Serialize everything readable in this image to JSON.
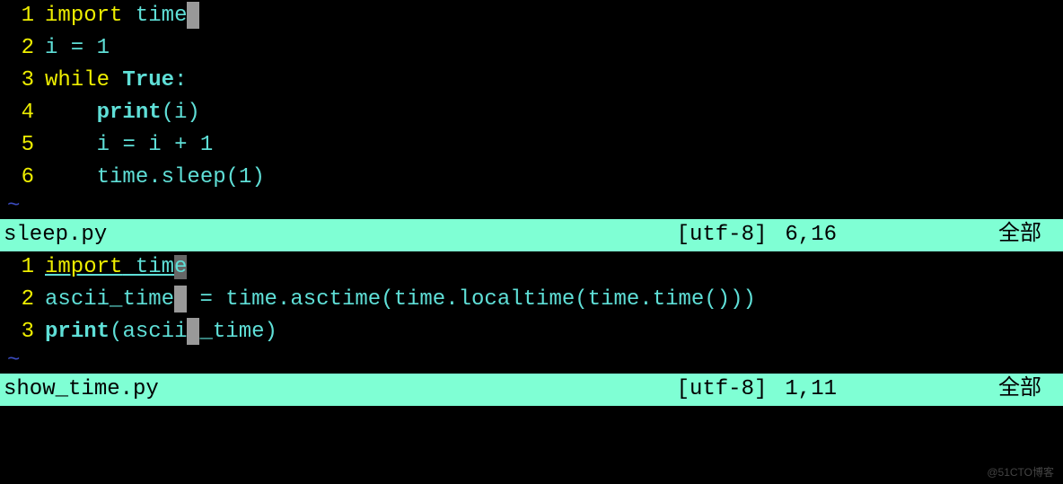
{
  "pane1": {
    "lines": [
      {
        "num": "1",
        "tokens": [
          {
            "t": "import",
            "cls": "keyword"
          },
          {
            "t": " time",
            "cls": "teal"
          }
        ]
      },
      {
        "num": "2",
        "tokens": [
          {
            "t": "i = 1",
            "cls": "teal"
          }
        ]
      },
      {
        "num": "3",
        "tokens": [
          {
            "t": "while",
            "cls": "keyword"
          },
          {
            "t": " ",
            "cls": "teal"
          },
          {
            "t": "True",
            "cls": "bold-teal"
          },
          {
            "t": ":",
            "cls": "teal"
          }
        ]
      },
      {
        "num": "4",
        "tokens": [
          {
            "t": "    ",
            "cls": "teal"
          },
          {
            "t": "print",
            "cls": "bold-teal"
          },
          {
            "t": "(i)",
            "cls": "teal"
          }
        ]
      },
      {
        "num": "5",
        "tokens": [
          {
            "t": "    i = i + 1",
            "cls": "teal"
          }
        ]
      },
      {
        "num": "6",
        "tokens": [
          {
            "t": "    time.sleep(1)",
            "cls": "teal"
          }
        ]
      }
    ],
    "cursor_marks": {
      "0": 11,
      "4": 15
    },
    "status": {
      "filename": "sleep.py",
      "encoding": "[utf-8]",
      "position": "6,16",
      "scroll": "全部"
    }
  },
  "pane2": {
    "lines": [
      {
        "num": "1",
        "tokens": [
          {
            "t": "import",
            "cls": "keyword underline"
          },
          {
            "t": " tim",
            "cls": "teal underline"
          },
          {
            "t": "e",
            "cls": "cursor-underline"
          }
        ]
      },
      {
        "num": "2",
        "tokens": [
          {
            "t": "ascii_time",
            "cls": "teal"
          },
          {
            "t": " = time.asctime(time.localtime(time.time()))",
            "cls": "teal"
          }
        ]
      },
      {
        "num": "3",
        "tokens": [
          {
            "t": "print",
            "cls": "bold-teal"
          },
          {
            "t": "(asci",
            "cls": "teal"
          },
          {
            "t": "i_time)",
            "cls": "teal"
          }
        ]
      }
    ],
    "cursor_marks": {
      "1": 10,
      "2": 11
    },
    "status": {
      "filename": "show_time.py",
      "encoding": "[utf-8]",
      "position": "1,11",
      "scroll": "全部"
    }
  },
  "tilde": "~",
  "watermark": "@51CTO博客"
}
